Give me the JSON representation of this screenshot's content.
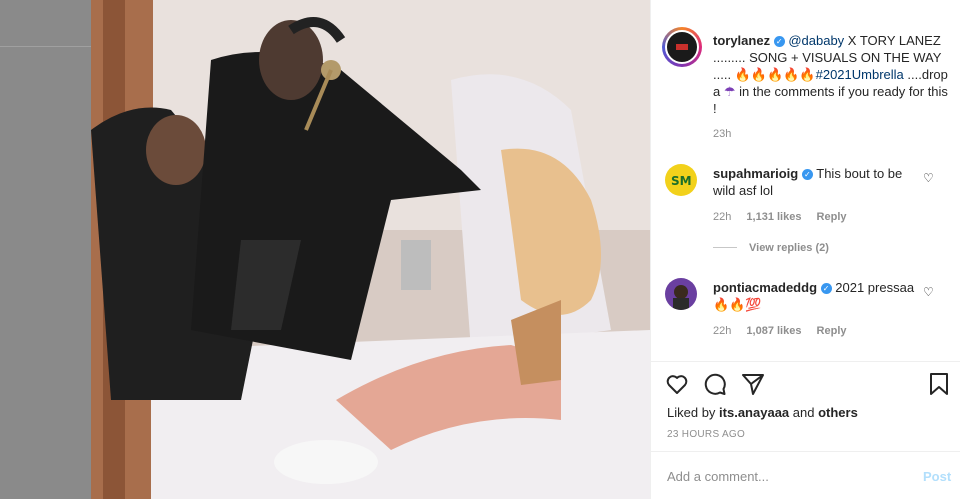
{
  "post": {
    "author": "torylanez",
    "caption_mention": "@dababy",
    "caption_part1": " X TORY LANEZ ......... SONG + VISUALS ON THE WAY ..... ",
    "caption_emoji": "🔥🔥🔥🔥🔥",
    "caption_hashtag": "#2021Umbrella",
    "caption_part2": " ....drop a ",
    "caption_umbrella": "☂",
    "caption_part3": " in the comments if you ready for this !",
    "time": "23h"
  },
  "comments": [
    {
      "username": "supahmarioig",
      "text": "This bout to be wild asf lol",
      "time": "22h",
      "likes": "1,131 likes",
      "reply_label": "Reply",
      "view_replies": "View replies (2)"
    },
    {
      "username": "pontiacmadeddg",
      "text": "2021 pressaa",
      "emoji": "🔥🔥💯",
      "time": "22h",
      "likes": "1,087 likes",
      "reply_label": "Reply"
    }
  ],
  "likes_line": {
    "prefix": "Liked by ",
    "user": "its.anayaaa",
    "middle": " and ",
    "others": "others"
  },
  "post_date": "23 HOURS AGO",
  "comment_box": {
    "placeholder": "Add a comment...",
    "post_label": "Post"
  },
  "icons": {
    "like": "heart-icon",
    "comment": "comment-icon",
    "share": "share-icon",
    "save": "bookmark-icon"
  },
  "colors": {
    "link": "#00376b",
    "verified": "#3897f0",
    "post_button": "#b2dffc"
  }
}
